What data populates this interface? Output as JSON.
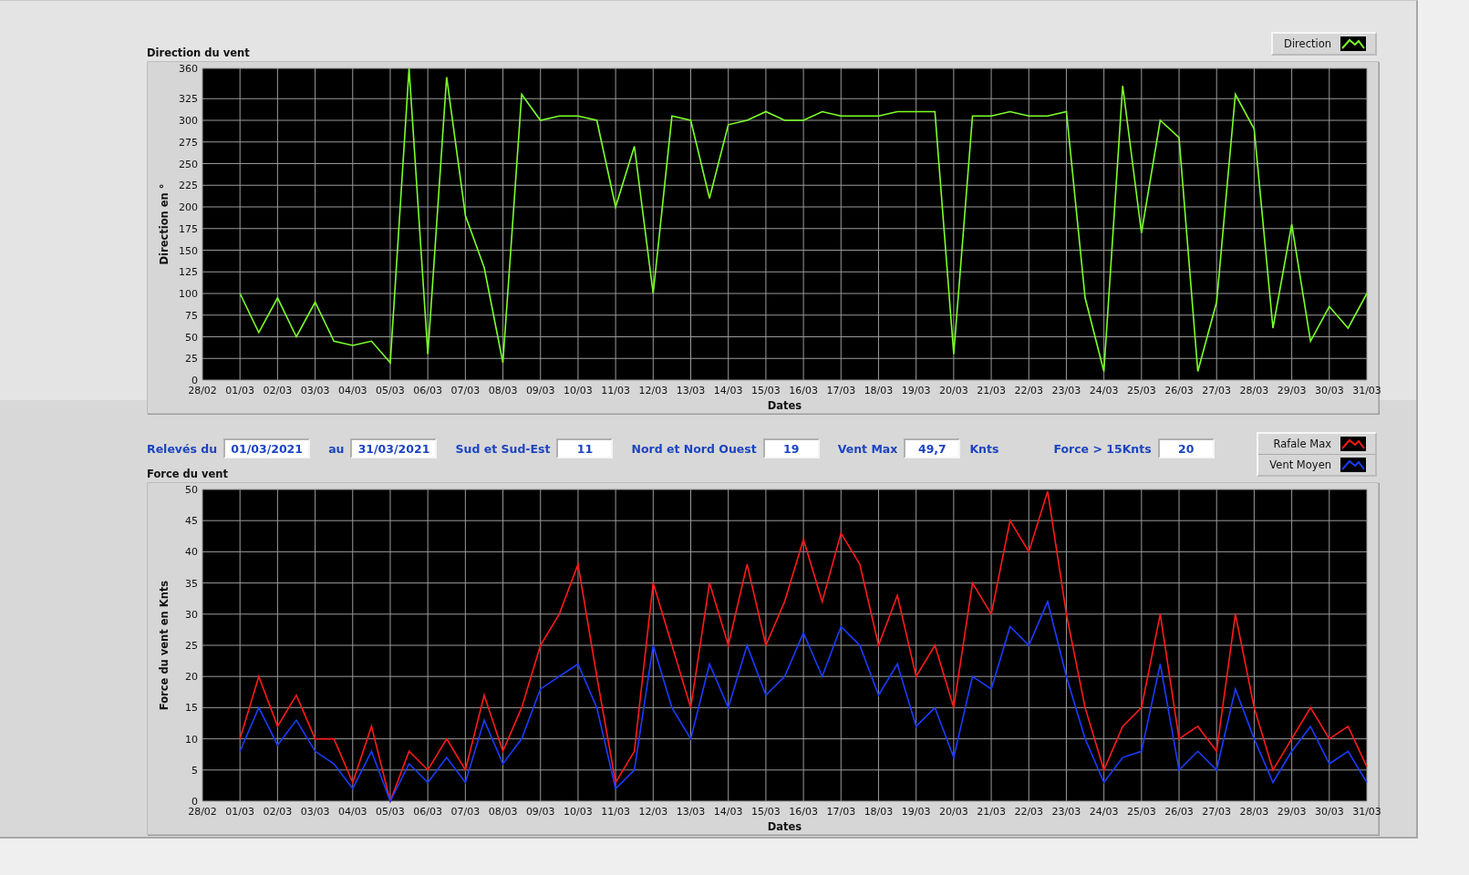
{
  "charts": [
    {
      "title": "Direction du vent",
      "chart_data": {
        "type": "line",
        "grid": true,
        "xlabel": "Dates",
        "ylabel": "Direction en °",
        "ylim": [
          0,
          360
        ],
        "yticks": [
          0,
          25,
          50,
          75,
          100,
          125,
          150,
          175,
          200,
          225,
          250,
          275,
          300,
          325,
          360
        ],
        "categories": [
          "28/02",
          null,
          "01/03",
          null,
          "02/03",
          null,
          "03/03",
          null,
          "04/03",
          null,
          "05/03",
          null,
          "06/03",
          null,
          "07/03",
          null,
          "08/03",
          null,
          "09/03",
          null,
          "10/03",
          null,
          "11/03",
          null,
          "12/03",
          null,
          "13/03",
          null,
          "14/03",
          null,
          "15/03",
          null,
          "16/03",
          null,
          "17/03",
          null,
          "18/03",
          null,
          "19/03",
          null,
          "20/03",
          null,
          "21/03",
          null,
          "22/03",
          null,
          "23/03",
          null,
          "24/03",
          null,
          "25/03",
          null,
          "26/03",
          null,
          "27/03",
          null,
          "28/03",
          null,
          "29/03",
          null,
          "30/03",
          null,
          "31/03"
        ],
        "series": [
          {
            "name": "Direction",
            "color": "#7cff2a",
            "values": [
              null,
              null,
              100,
              55,
              95,
              50,
              90,
              45,
              40,
              45,
              20,
              360,
              30,
              350,
              190,
              130,
              20,
              330,
              300,
              305,
              305,
              300,
              200,
              270,
              100,
              305,
              300,
              210,
              295,
              300,
              310,
              300,
              300,
              310,
              305,
              305,
              305,
              310,
              310,
              310,
              30,
              305,
              305,
              310,
              305,
              305,
              310,
              95,
              10,
              340,
              170,
              300,
              280,
              10,
              90,
              330,
              290,
              60,
              180,
              45,
              85,
              60,
              100
            ]
          }
        ]
      }
    },
    {
      "title": "Force du vent",
      "chart_data": {
        "type": "line",
        "grid": true,
        "xlabel": "Dates",
        "ylabel": "Force du vent en Knts",
        "ylim": [
          0,
          50
        ],
        "yticks": [
          0,
          5,
          10,
          15,
          20,
          25,
          30,
          35,
          40,
          45,
          50
        ],
        "categories": [
          "28/02",
          null,
          "01/03",
          null,
          "02/03",
          null,
          "03/03",
          null,
          "04/03",
          null,
          "05/03",
          null,
          "06/03",
          null,
          "07/03",
          null,
          "08/03",
          null,
          "09/03",
          null,
          "10/03",
          null,
          "11/03",
          null,
          "12/03",
          null,
          "13/03",
          null,
          "14/03",
          null,
          "15/03",
          null,
          "16/03",
          null,
          "17/03",
          null,
          "18/03",
          null,
          "19/03",
          null,
          "20/03",
          null,
          "21/03",
          null,
          "22/03",
          null,
          "23/03",
          null,
          "24/03",
          null,
          "25/03",
          null,
          "26/03",
          null,
          "27/03",
          null,
          "28/03",
          null,
          "29/03",
          null,
          "30/03",
          null,
          "31/03"
        ],
        "series": [
          {
            "name": "Rafale Max",
            "color": "#ff1a1a",
            "values": [
              null,
              null,
              10,
              20,
              12,
              17,
              10,
              10,
              3,
              12,
              0,
              8,
              5,
              10,
              5,
              17,
              8,
              15,
              25,
              30,
              38,
              20,
              3,
              8,
              35,
              25,
              15,
              35,
              25,
              38,
              25,
              32,
              42,
              32,
              43,
              38,
              25,
              33,
              20,
              25,
              15,
              35,
              30,
              45,
              40,
              49.7,
              30,
              15,
              5,
              12,
              15,
              30,
              10,
              12,
              8,
              30,
              15,
              5,
              10,
              15,
              10,
              12,
              5.5
            ]
          },
          {
            "name": "Vent Moyen",
            "color": "#1a3cff",
            "values": [
              null,
              null,
              8,
              15,
              9,
              13,
              8,
              6,
              2,
              8,
              0,
              6,
              3,
              7,
              3,
              13,
              6,
              10,
              18,
              20,
              22,
              15,
              2,
              5,
              25,
              15,
              10,
              22,
              15,
              25,
              17,
              20,
              27,
              20,
              28,
              25,
              17,
              22,
              12,
              15,
              7,
              20,
              18,
              28,
              25,
              32,
              20,
              10,
              3,
              7,
              8,
              22,
              5,
              8,
              5,
              18,
              10,
              3,
              8,
              12,
              6,
              8,
              3
            ]
          }
        ]
      }
    }
  ],
  "filters": [
    {
      "label": "Relevés du",
      "value": "01/03/2021"
    },
    {
      "label": "au",
      "value": "31/03/2021"
    },
    {
      "label": "Sud et Sud-Est",
      "value": "11"
    },
    {
      "label": "Nord et Nord Ouest",
      "value": "19"
    },
    {
      "label": "Vent Max",
      "value": "49,7",
      "unit": "Knts"
    },
    {
      "label": "Force > 15Knts",
      "value": "20"
    }
  ]
}
